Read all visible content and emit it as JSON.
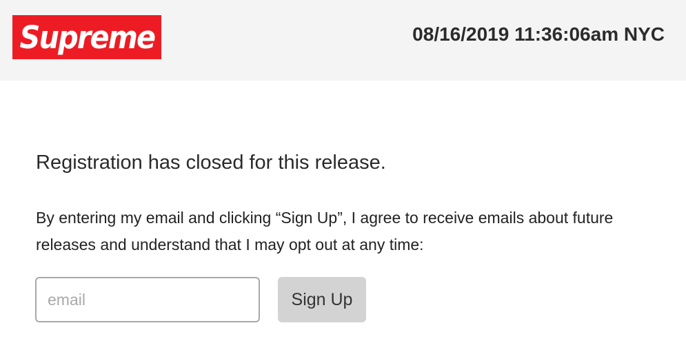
{
  "header": {
    "logo_text": "Supreme",
    "datetime": "08/16/2019 11:36:06am NYC"
  },
  "main": {
    "headline": "Registration has closed for this release.",
    "consent_text": "By entering my email and clicking “Sign Up”, I agree to receive emails about future releases and understand that I may opt out at any time:",
    "email_placeholder": "email",
    "email_value": "",
    "signup_label": "Sign Up"
  },
  "colors": {
    "brand_red": "#ed1c24",
    "header_bg": "#f4f4f4",
    "button_bg": "#d3d3d3"
  }
}
